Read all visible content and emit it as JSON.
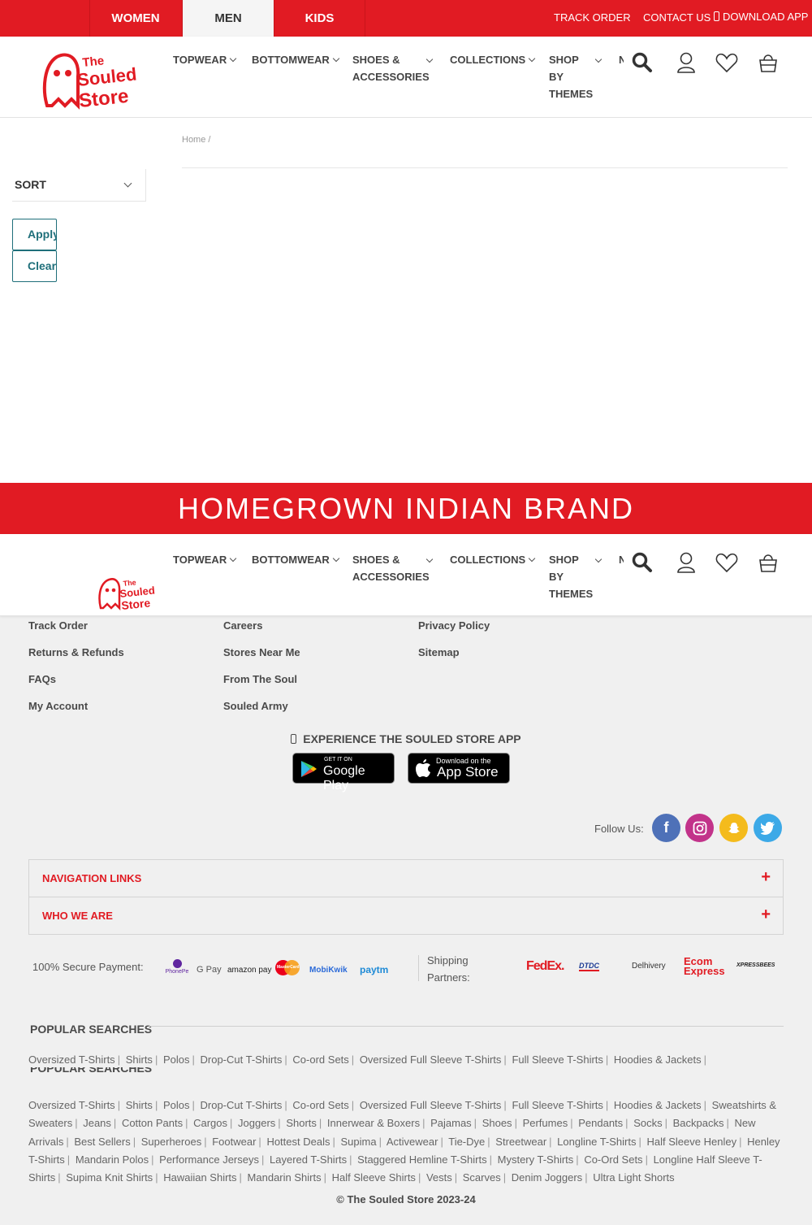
{
  "top_bar": {
    "tabs": [
      "WOMEN",
      "MEN",
      "KIDS"
    ],
    "active_tab": "MEN",
    "track_order": "TRACK ORDER",
    "contact_us": "CONTACT US",
    "download_app": "DOWNLOAD APP"
  },
  "header": {
    "logo_text": "The Souled Store",
    "nav": [
      "TOPWEAR",
      "BOTTOMWEAR",
      "SHOES &",
      "ACCESSORIES",
      "COLLECTIONS",
      "SHOP",
      "BY",
      "THEMES",
      "N"
    ]
  },
  "sidebar": {
    "sort_label": "SORT",
    "apply_label": "Apply",
    "clear_label": "Clear"
  },
  "breadcrumb": {
    "home": "Home",
    "sep": "/"
  },
  "banner": {
    "text": "HOMEGROWN INDIAN BRAND"
  },
  "footer": {
    "col1": [
      "Track Order",
      "Returns & Refunds",
      "FAQs",
      "My Account"
    ],
    "col2": [
      "Careers",
      "Stores Near Me",
      "From The Soul",
      "Souled Army"
    ],
    "col3": [
      "Privacy Policy",
      "Sitemap"
    ],
    "app_heading": "EXPERIENCE THE SOULED STORE APP",
    "google_play": {
      "small": "GET IT ON",
      "big": "Google Play"
    },
    "app_store": {
      "small": "Download on the",
      "big": "App Store"
    },
    "follow_us": "Follow Us:",
    "social": [
      "facebook-icon",
      "instagram-icon",
      "snapchat-icon",
      "twitter-icon"
    ],
    "accordion": [
      "NAVIGATION LINKS",
      "WHO WE ARE"
    ],
    "secure_payment": "100% Secure Payment:",
    "payment_methods": [
      "PhonePe",
      "G Pay",
      "amazon pay",
      "MasterCard",
      "MobiKwik",
      "paytm"
    ],
    "shipping_partners": [
      "Shipping",
      "Partners:"
    ],
    "couriers": [
      "FedEx.",
      "DTDC",
      "Delhivery",
      "Ecom Express",
      "XPRESSBEES"
    ],
    "popular_heading": "POPULAR SEARCHES",
    "popular_row1": [
      "Oversized T-Shirts",
      "Shirts",
      "Polos",
      "Drop-Cut T-Shirts",
      "Co-ord Sets",
      "Oversized Full Sleeve T-Shirts",
      "Full Sleeve T-Shirts",
      "Hoodies & Jackets"
    ],
    "popular_full": [
      "Oversized T-Shirts",
      "Shirts",
      "Polos",
      "Drop-Cut T-Shirts",
      "Co-ord Sets",
      "Oversized Full Sleeve T-Shirts",
      "Full Sleeve T-Shirts",
      "Hoodies & Jackets",
      "Sweatshirts & Sweaters",
      "Jeans",
      "Cotton Pants",
      "Cargos",
      "Joggers",
      "Shorts",
      "Innerwear & Boxers",
      "Pajamas",
      "Shoes",
      "Perfumes",
      "Pendants",
      "Socks",
      "Backpacks",
      "New Arrivals",
      "Best Sellers",
      "Superheroes",
      "Footwear",
      "Hottest Deals",
      "Supima",
      "Activewear",
      "Tie-Dye",
      "Streetwear",
      "Longline T-Shirts",
      "Half Sleeve Henley",
      "Henley T-Shirts",
      "Mandarin Polos",
      "Performance Jerseys",
      "Layered T-Shirts",
      "Staggered Hemline T-Shirts",
      "Mystery T-Shirts",
      "Co-Ord Sets",
      "Longline Half Sleeve T-Shirts",
      "Supima Knit Shirts",
      "Hawaiian Shirts",
      "Mandarin Shirts",
      "Half Sleeve Shirts",
      "Vests",
      "Scarves",
      "Denim Joggers",
      "Ultra Light Shorts"
    ],
    "copyright": "© The Souled Store 2023-24"
  },
  "colors": {
    "brand_red": "#e11b23",
    "teal": "#1f6f7a"
  }
}
